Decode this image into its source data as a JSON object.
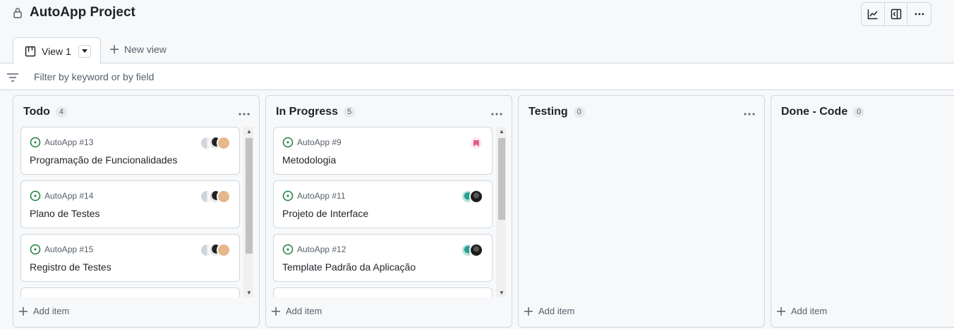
{
  "project": {
    "title": "AutoApp Project"
  },
  "toolbar": {
    "icons": [
      "chart-icon",
      "sidebar-panel-icon",
      "more-icon"
    ]
  },
  "tabs": {
    "active_label": "View 1",
    "new_view_label": "New view"
  },
  "filter": {
    "placeholder": "Filter by keyword or by field"
  },
  "columns": [
    {
      "title": "Todo",
      "count": "4",
      "add_label": "Add item",
      "cards": [
        {
          "ref": "AutoApp #13",
          "title": "Programação de Funcionalidades"
        },
        {
          "ref": "AutoApp #14",
          "title": "Plano de Testes"
        },
        {
          "ref": "AutoApp #15",
          "title": "Registro de Testes"
        }
      ]
    },
    {
      "title": "In Progress",
      "count": "5",
      "add_label": "Add item",
      "cards": [
        {
          "ref": "AutoApp #9",
          "title": "Metodologia"
        },
        {
          "ref": "AutoApp #11",
          "title": "Projeto de Interface"
        },
        {
          "ref": "AutoApp #12",
          "title": "Template Padrão da Aplicação"
        }
      ]
    },
    {
      "title": "Testing",
      "count": "0",
      "add_label": "Add item",
      "cards": []
    },
    {
      "title": "Done - Code",
      "count": "0",
      "add_label": "Add item",
      "cards": []
    }
  ],
  "colors": {
    "open_issue": "#1a7f37",
    "border": "#d0d7de",
    "muted": "#57606a"
  }
}
